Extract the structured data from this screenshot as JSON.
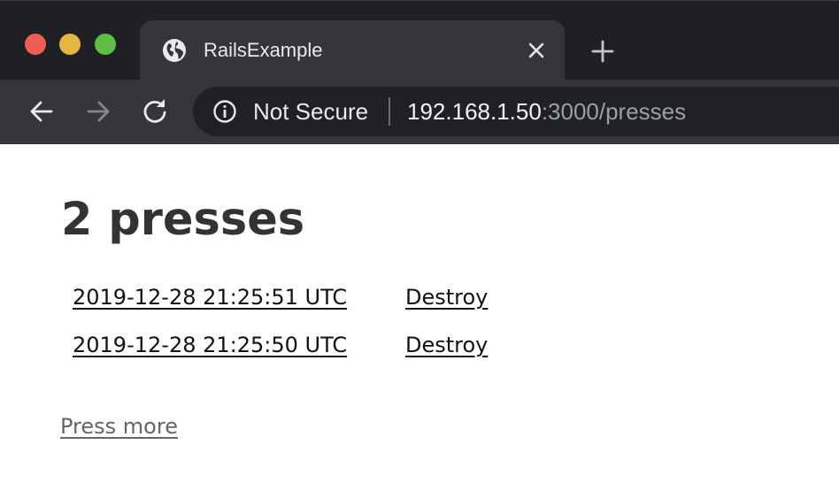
{
  "browser": {
    "tab": {
      "title": "RailsExample",
      "favicon": "globe-icon"
    },
    "omnibox": {
      "security_label": "Not Secure",
      "url_host": "192.168.1.50",
      "url_rest": ":3000/presses"
    },
    "icons": {
      "back": "back-arrow-icon",
      "forward": "forward-arrow-icon",
      "reload": "reload-icon",
      "info": "info-icon",
      "close": "close-icon",
      "new_tab": "plus-icon"
    },
    "colors": {
      "titlebar": "#1f2023",
      "toolbar": "#35363a",
      "omnibox": "#202124",
      "traffic_red": "#ee5e55",
      "traffic_yellow": "#e3b63f",
      "traffic_green": "#5fbf45"
    }
  },
  "page": {
    "title": "2 presses",
    "presses": [
      {
        "time": "2019-12-28 21:25:51 UTC",
        "destroy_label": "Destroy"
      },
      {
        "time": "2019-12-28 21:25:50 UTC",
        "destroy_label": "Destroy"
      }
    ],
    "press_more_label": "Press more"
  }
}
